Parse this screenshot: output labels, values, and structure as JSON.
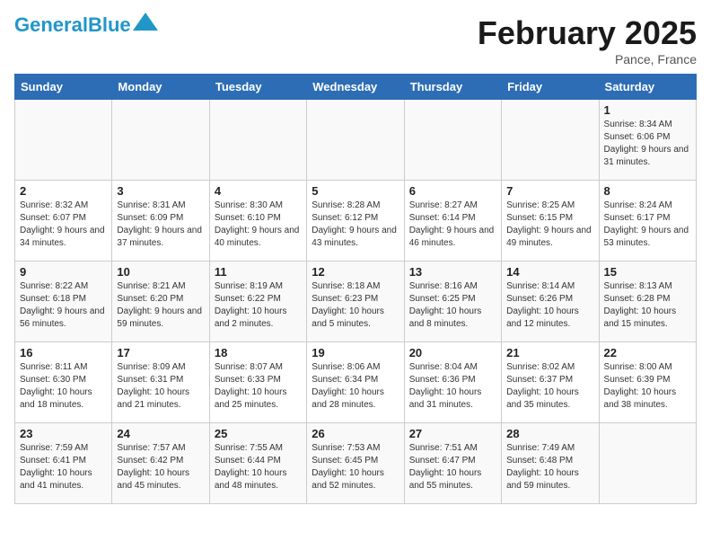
{
  "header": {
    "logo_general": "General",
    "logo_blue": "Blue",
    "month_title": "February 2025",
    "location": "Pance, France"
  },
  "days_of_week": [
    "Sunday",
    "Monday",
    "Tuesday",
    "Wednesday",
    "Thursday",
    "Friday",
    "Saturday"
  ],
  "weeks": [
    [
      {
        "day": "",
        "info": ""
      },
      {
        "day": "",
        "info": ""
      },
      {
        "day": "",
        "info": ""
      },
      {
        "day": "",
        "info": ""
      },
      {
        "day": "",
        "info": ""
      },
      {
        "day": "",
        "info": ""
      },
      {
        "day": "1",
        "info": "Sunrise: 8:34 AM\nSunset: 6:06 PM\nDaylight: 9 hours and 31 minutes."
      }
    ],
    [
      {
        "day": "2",
        "info": "Sunrise: 8:32 AM\nSunset: 6:07 PM\nDaylight: 9 hours and 34 minutes."
      },
      {
        "day": "3",
        "info": "Sunrise: 8:31 AM\nSunset: 6:09 PM\nDaylight: 9 hours and 37 minutes."
      },
      {
        "day": "4",
        "info": "Sunrise: 8:30 AM\nSunset: 6:10 PM\nDaylight: 9 hours and 40 minutes."
      },
      {
        "day": "5",
        "info": "Sunrise: 8:28 AM\nSunset: 6:12 PM\nDaylight: 9 hours and 43 minutes."
      },
      {
        "day": "6",
        "info": "Sunrise: 8:27 AM\nSunset: 6:14 PM\nDaylight: 9 hours and 46 minutes."
      },
      {
        "day": "7",
        "info": "Sunrise: 8:25 AM\nSunset: 6:15 PM\nDaylight: 9 hours and 49 minutes."
      },
      {
        "day": "8",
        "info": "Sunrise: 8:24 AM\nSunset: 6:17 PM\nDaylight: 9 hours and 53 minutes."
      }
    ],
    [
      {
        "day": "9",
        "info": "Sunrise: 8:22 AM\nSunset: 6:18 PM\nDaylight: 9 hours and 56 minutes."
      },
      {
        "day": "10",
        "info": "Sunrise: 8:21 AM\nSunset: 6:20 PM\nDaylight: 9 hours and 59 minutes."
      },
      {
        "day": "11",
        "info": "Sunrise: 8:19 AM\nSunset: 6:22 PM\nDaylight: 10 hours and 2 minutes."
      },
      {
        "day": "12",
        "info": "Sunrise: 8:18 AM\nSunset: 6:23 PM\nDaylight: 10 hours and 5 minutes."
      },
      {
        "day": "13",
        "info": "Sunrise: 8:16 AM\nSunset: 6:25 PM\nDaylight: 10 hours and 8 minutes."
      },
      {
        "day": "14",
        "info": "Sunrise: 8:14 AM\nSunset: 6:26 PM\nDaylight: 10 hours and 12 minutes."
      },
      {
        "day": "15",
        "info": "Sunrise: 8:13 AM\nSunset: 6:28 PM\nDaylight: 10 hours and 15 minutes."
      }
    ],
    [
      {
        "day": "16",
        "info": "Sunrise: 8:11 AM\nSunset: 6:30 PM\nDaylight: 10 hours and 18 minutes."
      },
      {
        "day": "17",
        "info": "Sunrise: 8:09 AM\nSunset: 6:31 PM\nDaylight: 10 hours and 21 minutes."
      },
      {
        "day": "18",
        "info": "Sunrise: 8:07 AM\nSunset: 6:33 PM\nDaylight: 10 hours and 25 minutes."
      },
      {
        "day": "19",
        "info": "Sunrise: 8:06 AM\nSunset: 6:34 PM\nDaylight: 10 hours and 28 minutes."
      },
      {
        "day": "20",
        "info": "Sunrise: 8:04 AM\nSunset: 6:36 PM\nDaylight: 10 hours and 31 minutes."
      },
      {
        "day": "21",
        "info": "Sunrise: 8:02 AM\nSunset: 6:37 PM\nDaylight: 10 hours and 35 minutes."
      },
      {
        "day": "22",
        "info": "Sunrise: 8:00 AM\nSunset: 6:39 PM\nDaylight: 10 hours and 38 minutes."
      }
    ],
    [
      {
        "day": "23",
        "info": "Sunrise: 7:59 AM\nSunset: 6:41 PM\nDaylight: 10 hours and 41 minutes."
      },
      {
        "day": "24",
        "info": "Sunrise: 7:57 AM\nSunset: 6:42 PM\nDaylight: 10 hours and 45 minutes."
      },
      {
        "day": "25",
        "info": "Sunrise: 7:55 AM\nSunset: 6:44 PM\nDaylight: 10 hours and 48 minutes."
      },
      {
        "day": "26",
        "info": "Sunrise: 7:53 AM\nSunset: 6:45 PM\nDaylight: 10 hours and 52 minutes."
      },
      {
        "day": "27",
        "info": "Sunrise: 7:51 AM\nSunset: 6:47 PM\nDaylight: 10 hours and 55 minutes."
      },
      {
        "day": "28",
        "info": "Sunrise: 7:49 AM\nSunset: 6:48 PM\nDaylight: 10 hours and 59 minutes."
      },
      {
        "day": "",
        "info": ""
      }
    ]
  ]
}
